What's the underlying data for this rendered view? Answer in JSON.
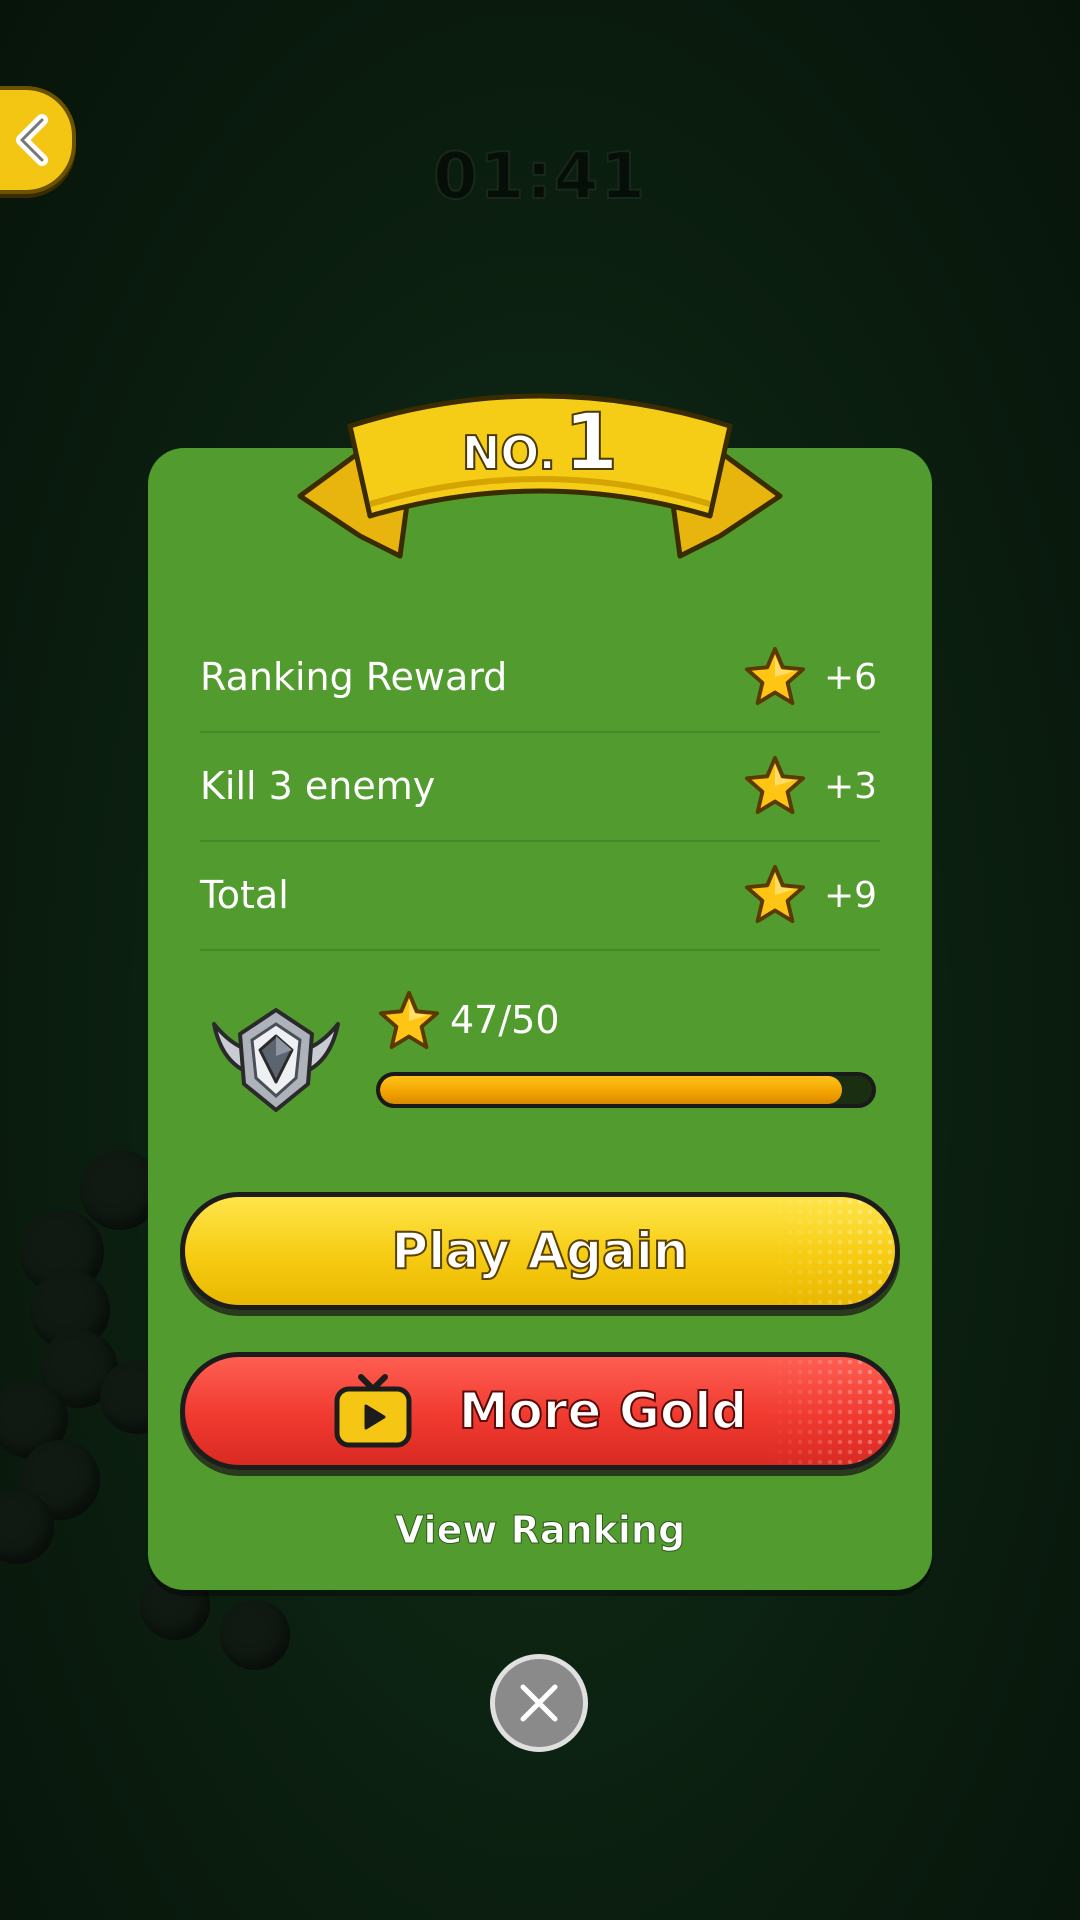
{
  "hud": {
    "timer": "01:41"
  },
  "result": {
    "rank_prefix": "NO.",
    "rank_number": "1"
  },
  "rewards": [
    {
      "label": "Ranking Reward",
      "value": "+6"
    },
    {
      "label": "Kill 3 enemy",
      "value": "+3"
    },
    {
      "label": "Total",
      "value": "+9"
    }
  ],
  "progress": {
    "text": "47/50",
    "current": 47,
    "max": 50
  },
  "buttons": {
    "play_again": "Play Again",
    "more_gold": "More Gold",
    "view_ranking": "View Ranking"
  },
  "icons": {
    "back": "chevron-left-icon",
    "star": "star-icon",
    "badge": "rank-badge-icon",
    "video": "tv-play-icon",
    "close": "close-icon"
  },
  "colors": {
    "panel": "#529b2e",
    "play_again": "#f6cc12",
    "more_gold": "#f03a30",
    "progress_fill": "#f2a200",
    "ribbon": "#f3c614"
  }
}
